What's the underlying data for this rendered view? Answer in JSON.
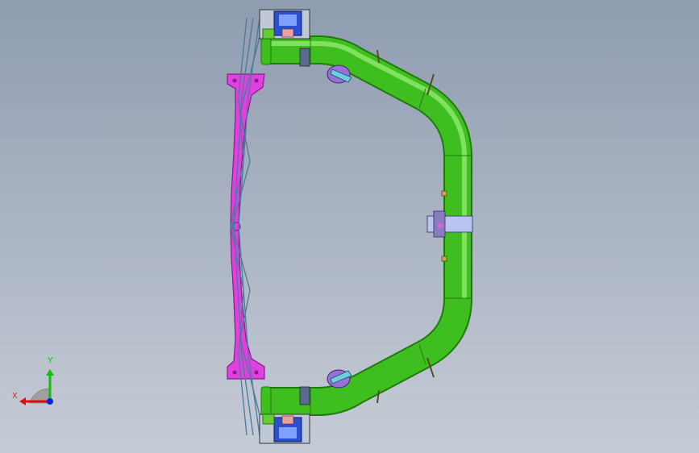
{
  "viewport": {
    "background_top": "#8f9cb0",
    "background_bottom": "#c6ccd6"
  },
  "colors": {
    "tube": "#3fbf1f",
    "tube_dark": "#1f7a0c",
    "tube_light": "#9cf07a",
    "bracket": "#e040e0",
    "bracket_dark": "#8a1a8a",
    "mount": "#2a4fd0",
    "mount_light": "#7fa0ff",
    "clamp": "#b9c4f0",
    "spring": "#4a7a9a",
    "knuckle": "#9a6fd8"
  },
  "triad": {
    "x_label": "X",
    "y_label": "Y",
    "x_color": "#e01010",
    "y_color": "#10c010",
    "z_color": "#1020e0",
    "label_color": "#d02020"
  },
  "model": {
    "parts": [
      "twist-beam-tube",
      "trailing-arm-bracket",
      "leaf-spring",
      "axle-mount-top",
      "axle-mount-bottom",
      "center-clamp"
    ]
  }
}
